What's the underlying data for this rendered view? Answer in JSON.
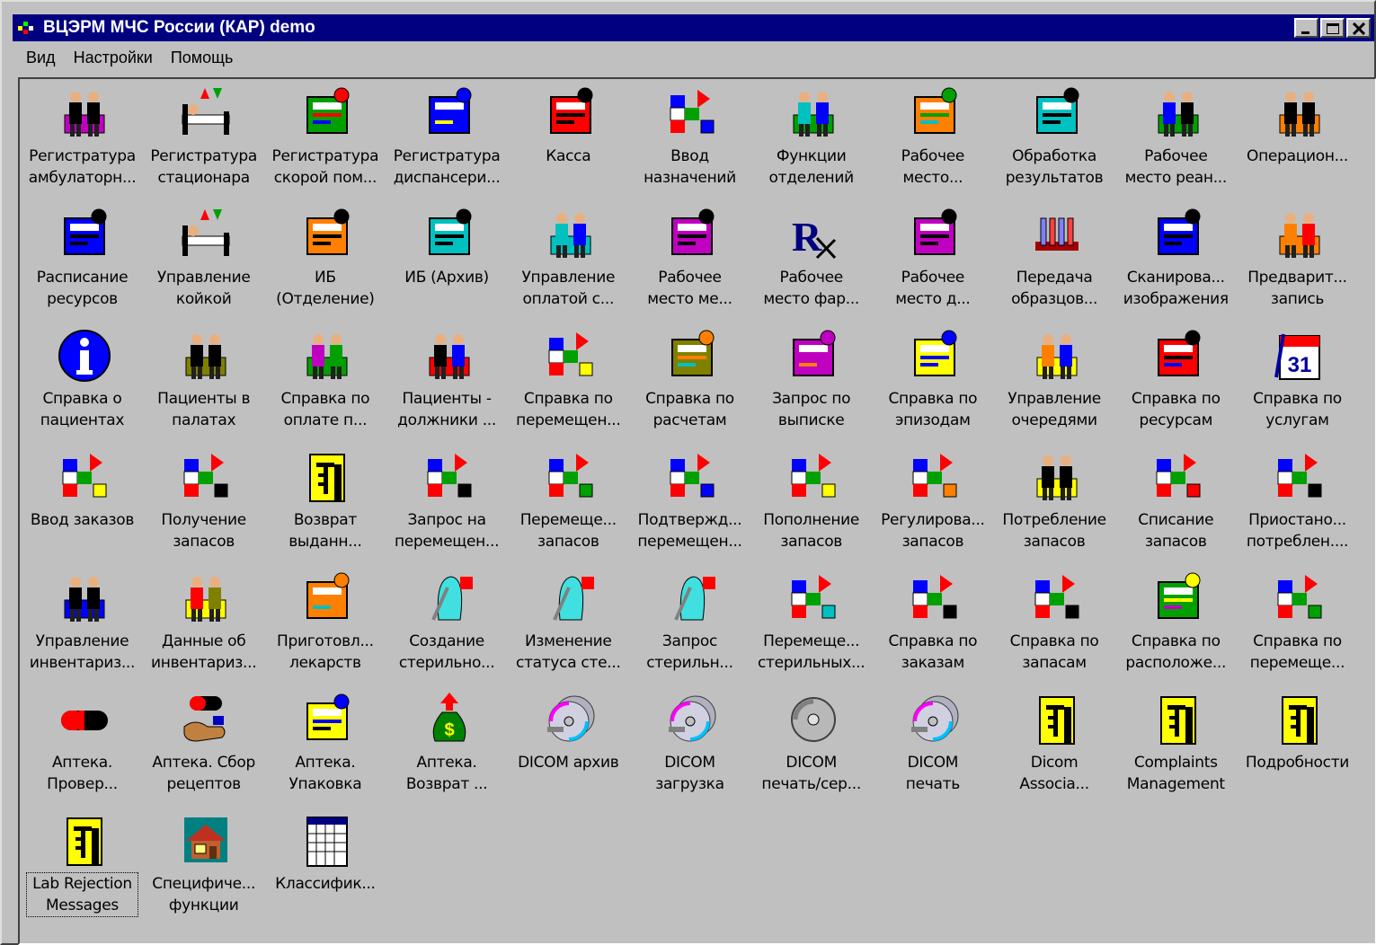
{
  "window": {
    "title": "ВЦЭРМ МЧС России (КАР) demo"
  },
  "menu": [
    "Вид",
    "Настройки",
    "Помощь"
  ],
  "items": [
    {
      "label": "Регистратура\nамбулаторн...",
      "icon": "registry-desk-icon"
    },
    {
      "label": "Регистратура\nстационара",
      "icon": "hospital-bed-admit-icon"
    },
    {
      "label": "Регистратура\nскорой пом...",
      "icon": "ambulance-icon"
    },
    {
      "label": "Регистратура\nдиспансери...",
      "icon": "treadmill-icon"
    },
    {
      "label": "Касса",
      "icon": "cash-register-icon"
    },
    {
      "label": "Ввод\nназначений",
      "icon": "clipboard-order-icon"
    },
    {
      "label": "Функции\nотделений",
      "icon": "nurse-station-icon"
    },
    {
      "label": "Рабочее\nместо...",
      "icon": "caduceus-icon"
    },
    {
      "label": "Обработка\nрезультатов",
      "icon": "results-processing-icon"
    },
    {
      "label": "Рабочее\nместо реан...",
      "icon": "icu-workplace-icon"
    },
    {
      "label": "Операцион...",
      "icon": "operating-room-icon"
    },
    {
      "label": "Расписание\nресурсов",
      "icon": "resource-schedule-icon"
    },
    {
      "label": "Управление\nкойкой",
      "icon": "bed-question-icon"
    },
    {
      "label": "ИБ\n(Отделение)",
      "icon": "file-cabinet-icon"
    },
    {
      "label": "ИБ (Архив)",
      "icon": "archive-icon"
    },
    {
      "label": "Управление\nоплатой с...",
      "icon": "payment-doc-question-icon"
    },
    {
      "label": "Рабочее\nместо ме...",
      "icon": "genie-lamp-icon"
    },
    {
      "label": "Рабочее\nместо фар...",
      "icon": "rx-icon"
    },
    {
      "label": "Рабочее\nместо д...",
      "icon": "fork-knife-glass-icon"
    },
    {
      "label": "Передача\nобразцов...",
      "icon": "test-tubes-icon"
    },
    {
      "label": "Сканирова...\nизображения",
      "icon": "scanner-icon"
    },
    {
      "label": "Предварит...\nзапись",
      "icon": "appointment-desk-icon"
    },
    {
      "label": "Справка о\nпациентах",
      "icon": "info-icon"
    },
    {
      "label": "Пациенты в\nпалатах",
      "icon": "patient-head-icon"
    },
    {
      "label": "Справка по\nоплате п...",
      "icon": "payment-person-icon"
    },
    {
      "label": "Пациенты -\nдолжники ...",
      "icon": "debtor-question-icon"
    },
    {
      "label": "Справка по\nперемещен...",
      "icon": "bed-transfer-icon"
    },
    {
      "label": "Справка по\nрасчетам",
      "icon": "folder-settlement-icon"
    },
    {
      "label": "Запрос по\nвыписке",
      "icon": "discharge-door-icon"
    },
    {
      "label": "Справка по\nэпизодам",
      "icon": "episodes-folder-icon"
    },
    {
      "label": "Управление\nочередями",
      "icon": "queue-people-icon"
    },
    {
      "label": "Справка по\nресурсам",
      "icon": "resource-calendar-icon"
    },
    {
      "label": "Справка по\nуслугам",
      "icon": "calendar-31-icon"
    },
    {
      "label": "Ввод заказов",
      "icon": "order-entry-icon"
    },
    {
      "label": "Получение\nзапасов",
      "icon": "receive-stock-icon"
    },
    {
      "label": "Возврат\nвыданн...",
      "icon": "yellow-doc-icon"
    },
    {
      "label": "Запрос на\nперемещен...",
      "icon": "transfer-request-icon"
    },
    {
      "label": "Перемеще...\nзапасов",
      "icon": "stock-transfer-icon"
    },
    {
      "label": "Подтвержд...\nперемещен...",
      "icon": "transfer-confirm-icon"
    },
    {
      "label": "Пополнение\nзапасов",
      "icon": "replenish-icon"
    },
    {
      "label": "Регулирова...\nзапасов",
      "icon": "stock-adjust-icon"
    },
    {
      "label": "Потребление\nзапасов",
      "icon": "consumption-icon"
    },
    {
      "label": "Списание\nзапасов",
      "icon": "write-off-icon"
    },
    {
      "label": "Приостано...\nпотреблен....",
      "icon": "suspend-shelf-icon"
    },
    {
      "label": "Управление\nинвентариз...",
      "icon": "inventory-manage-icon"
    },
    {
      "label": "Данные об\nинвентариз...",
      "icon": "inventory-data-icon"
    },
    {
      "label": "Приготовл...\nлекарств",
      "icon": "mortar-pestle-icon"
    },
    {
      "label": "Создание\nстерильно...",
      "icon": "sterile-create-icon"
    },
    {
      "label": "Изменение\nстатуса сте...",
      "icon": "sterile-status-icon"
    },
    {
      "label": "Запрос\nстерильн...",
      "icon": "sterile-request-icon"
    },
    {
      "label": "Перемеще...\nстерильных...",
      "icon": "sterile-transfer-icon"
    },
    {
      "label": "Справка по\nзаказам",
      "icon": "orders-report-icon"
    },
    {
      "label": "Справка по\nзапасам",
      "icon": "stock-report-icon"
    },
    {
      "label": "Справка по\nрасположе...",
      "icon": "location-report-icon"
    },
    {
      "label": "Справка по\nперемеще...",
      "icon": "transfer-report-icon"
    },
    {
      "label": "Аптека.\nПровер...",
      "icon": "capsule-icon"
    },
    {
      "label": "Аптека. Сбор\nрецептов",
      "icon": "pill-hand-icon"
    },
    {
      "label": "Аптека.\nУпаковка",
      "icon": "packaging-icon"
    },
    {
      "label": "Аптека.\nВозврат ...",
      "icon": "money-bag-icon"
    },
    {
      "label": "DICOM архив",
      "icon": "cd-stack-icon"
    },
    {
      "label": "DICOM\nзагрузка",
      "icon": "cd-stack-icon"
    },
    {
      "label": "DICOM\nпечать/сер...",
      "icon": "cd-single-icon"
    },
    {
      "label": "DICOM\nпечать",
      "icon": "cd-stack-icon"
    },
    {
      "label": "Dicom\nAssocia...",
      "icon": "yellow-doc-icon"
    },
    {
      "label": "Complaints\nManagement",
      "icon": "yellow-doc-icon"
    },
    {
      "label": "Подробности",
      "icon": "yellow-doc-icon"
    },
    {
      "label": "Lab Rejection\nMessages",
      "icon": "yellow-doc-icon",
      "focused": true
    },
    {
      "label": "Специфиче...\nфункции",
      "icon": "house-icon"
    },
    {
      "label": "Классифик...",
      "icon": "spreadsheet-icon"
    }
  ]
}
